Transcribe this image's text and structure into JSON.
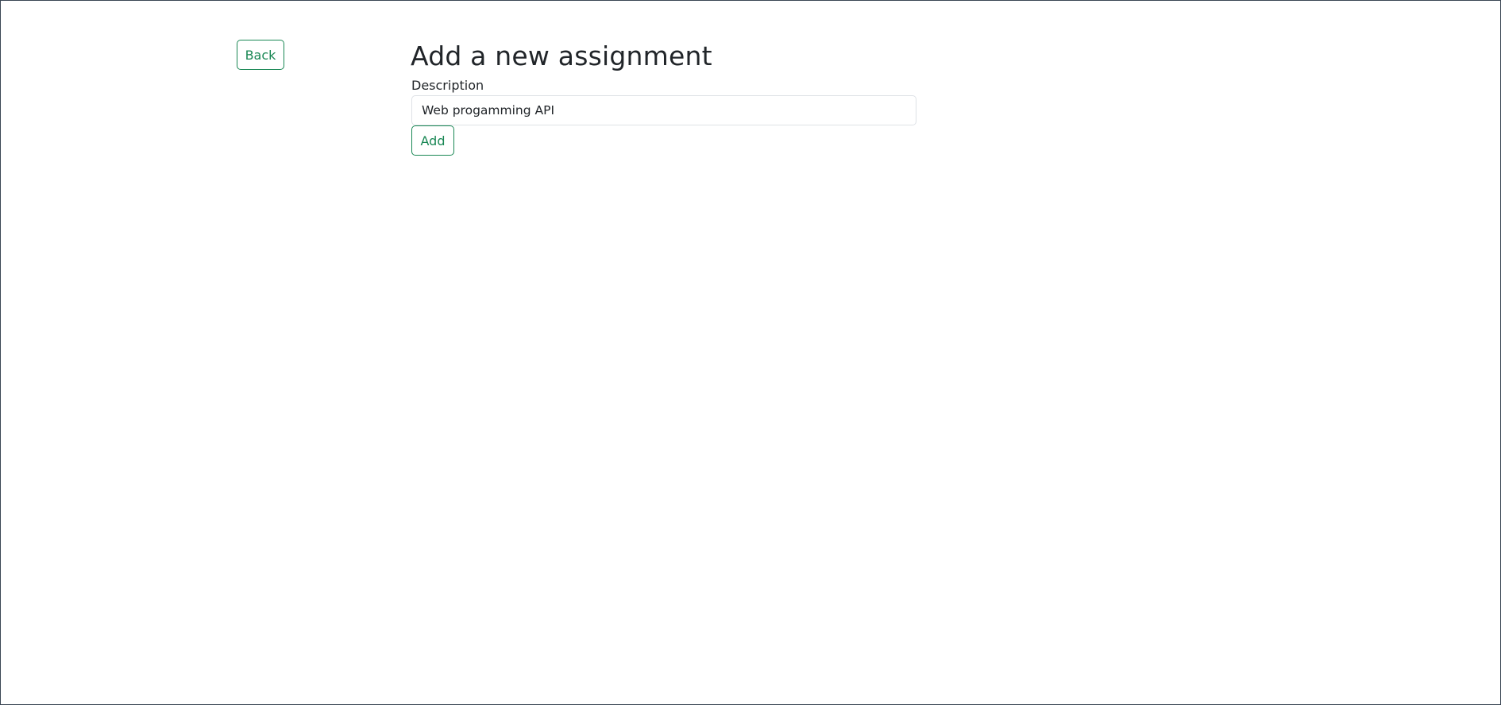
{
  "nav": {
    "back_label": "Back"
  },
  "form": {
    "title": "Add a new assignment",
    "description_label": "Description",
    "description_value": "Web progamming API",
    "submit_label": "Add"
  },
  "colors": {
    "accent": "#198754",
    "text": "#212529",
    "frame_border": "#3b4654",
    "input_border": "#dee2e6",
    "background": "#ffffff"
  }
}
